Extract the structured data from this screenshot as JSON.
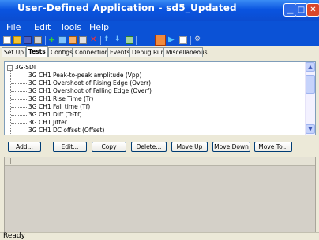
{
  "window": {
    "title": "User-Defined Application - sd5_Updated"
  },
  "menu": [
    "File",
    "Edit",
    "Tools",
    "Help"
  ],
  "toolbar": {
    "icons": [
      "new-icon",
      "open-icon",
      "save-icon",
      "print-icon",
      "add-icon",
      "chart-icon",
      "edit-icon",
      "copy-icon",
      "delete-icon",
      "move-up-icon",
      "move-down-icon",
      "chart-bars-icon",
      "run-icon",
      "play-icon",
      "document-icon",
      "settings-icon"
    ]
  },
  "tabs": [
    "Set Up",
    "Tests",
    "Configs",
    "Connections",
    "Events",
    "Debug Run",
    "Miscellaneous"
  ],
  "active_tab": "Tests",
  "tree": {
    "root": "3G-SDI",
    "items": [
      "3G CH1 Peak-to-peak amplitude (Vpp)",
      "3G CH1 Overshoot of Rising Edge (Overr)",
      "3G CH1 Overshoot of Falling Edge (Overf)",
      "3G CH1 Rise Time (Tr)",
      "3G CH1 Fall time (Tf)",
      "3G CH1 Diff (Tr-Tf)",
      "3G CH1 Jitter",
      "3G CH1 DC offset (Offset)"
    ]
  },
  "buttons": [
    "Add...",
    "Edit...",
    "Copy",
    "Delete...",
    "Move Up",
    "Move Down",
    "Move To..."
  ],
  "status": {
    "text": "Ready"
  }
}
